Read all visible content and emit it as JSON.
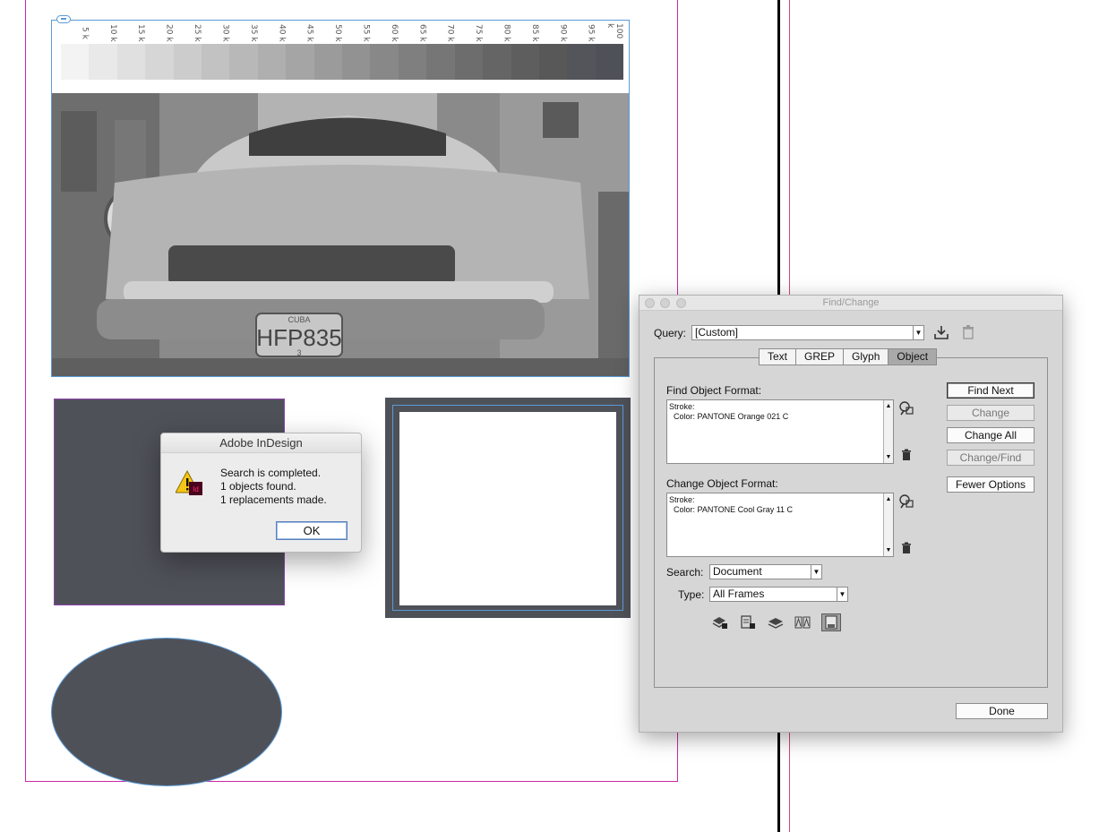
{
  "document": {
    "ramp_labels": [
      "5 k",
      "10 k",
      "15 k",
      "20 k",
      "25 k",
      "30 k",
      "35 k",
      "40 k",
      "45 k",
      "50 k",
      "55 k",
      "60 k",
      "65 k",
      "70 k",
      "75 k",
      "80 k",
      "85 k",
      "90 k",
      "95 k",
      "100 k"
    ],
    "ramp_colors": [
      "#f3f3f3",
      "#e9e9e9",
      "#e0e0e0",
      "#d6d6d6",
      "#cccccc",
      "#c2c2c2",
      "#b8b8b8",
      "#afafaf",
      "#a5a5a5",
      "#9b9b9b",
      "#929292",
      "#888888",
      "#7f7f7f",
      "#767676",
      "#6d6d6d",
      "#656565",
      "#5e5e5e",
      "#585858",
      "#53555b",
      "#4f5159"
    ],
    "photo": {
      "plate_top": "CUBA",
      "plate_number": "HFP835",
      "plate_bottom": "3"
    },
    "fill_color": "#4f5159"
  },
  "alert": {
    "title": "Adobe InDesign",
    "icon_badge": "Id",
    "message_lines": [
      "Search is completed.",
      "1 objects found.",
      "1 replacements made."
    ],
    "ok_label": "OK"
  },
  "find_change": {
    "title": "Find/Change",
    "query_label": "Query:",
    "query_value": "[Custom]",
    "tabs": [
      "Text",
      "GREP",
      "Glyph",
      "Object"
    ],
    "active_tab": "Object",
    "find_format_label": "Find Object Format:",
    "find_format_lines": [
      "Stroke:",
      "Color: PANTONE Orange 021 C"
    ],
    "change_format_label": "Change Object Format:",
    "change_format_lines": [
      "Stroke:",
      "Color: PANTONE Cool Gray 11 C"
    ],
    "search_label": "Search:",
    "search_value": "Document",
    "type_label": "Type:",
    "type_value": "All Frames",
    "buttons": {
      "find_next": "Find Next",
      "change": "Change",
      "change_all": "Change All",
      "change_find": "Change/Find",
      "fewer_options": "Fewer Options",
      "done": "Done"
    }
  }
}
